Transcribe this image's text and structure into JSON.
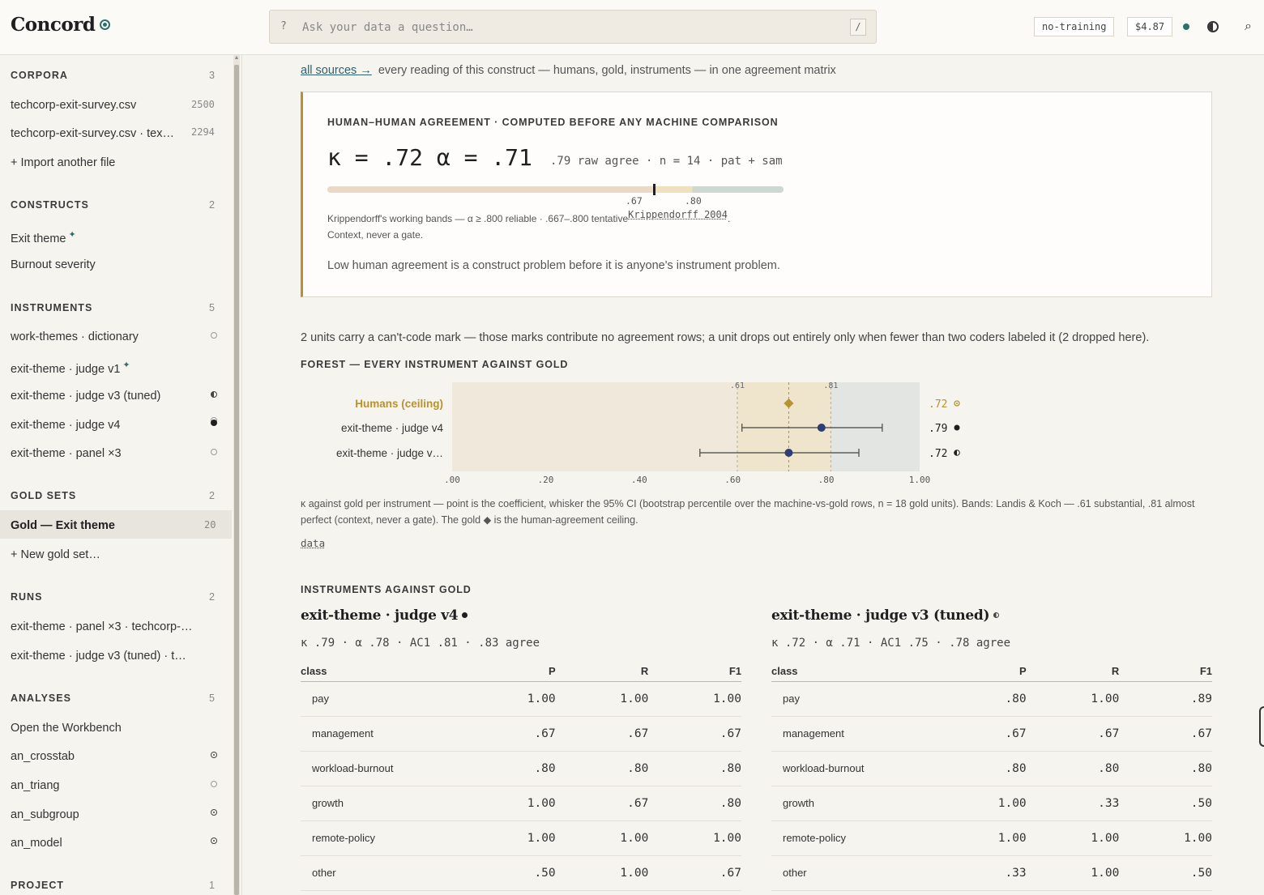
{
  "app": {
    "name": "Concord"
  },
  "search": {
    "prefix": "?",
    "placeholder": "Ask your data a question…",
    "shortcut": "/"
  },
  "topbar": {
    "mode": "no-training",
    "cost": "$4.87"
  },
  "sidebar": {
    "corpora": {
      "title": "CORPORA",
      "count": "3",
      "items": [
        {
          "label": "techcorp-exit-survey.csv",
          "num": "2500"
        },
        {
          "label": "techcorp-exit-survey.csv · tex…",
          "num": "2294"
        },
        {
          "label": "+ Import another file"
        }
      ]
    },
    "constructs": {
      "title": "CONSTRUCTS",
      "count": "2",
      "items": [
        {
          "label": "Exit theme",
          "badge": "✦"
        },
        {
          "label": "Burnout severity"
        }
      ]
    },
    "instruments": {
      "title": "INSTRUMENTS",
      "count": "5",
      "items": [
        {
          "label": "work-themes · dictionary"
        },
        {
          "label": "exit-theme · judge v1",
          "badge": "✦"
        },
        {
          "label": "exit-theme · judge v3 (tuned)"
        },
        {
          "label": "exit-theme · judge v4"
        },
        {
          "label": "exit-theme · panel ×3"
        }
      ]
    },
    "gold_sets": {
      "title": "GOLD SETS",
      "count": "2",
      "items": [
        {
          "label": "Gold — Exit theme",
          "num": "20"
        },
        {
          "label": "+ New gold set…"
        }
      ]
    },
    "runs": {
      "title": "RUNS",
      "count": "2",
      "items": [
        {
          "label": "exit-theme · panel ×3 · techcorp-…"
        },
        {
          "label": "exit-theme · judge v3 (tuned) · t…"
        }
      ]
    },
    "analyses": {
      "title": "ANALYSES",
      "count": "5",
      "items": [
        {
          "label": "Open the Workbench"
        },
        {
          "label": "an_crosstab"
        },
        {
          "label": "an_triang"
        },
        {
          "label": "an_subgroup"
        },
        {
          "label": "an_model"
        }
      ]
    },
    "project": {
      "title": "PROJECT",
      "count": "1"
    }
  },
  "main": {
    "all_sources_link": "all sources →",
    "all_sources_text": "every reading of this construct — humans, gold, instruments — in one agreement matrix",
    "agreement": {
      "heading": "HUMAN–HUMAN AGREEMENT · COMPUTED BEFORE ANY MACHINE COMPARISON",
      "headline": "κ = .72 α = .71",
      "sub": ".79 raw agree · n = 14 · pat + sam",
      "alpha_value": 0.71,
      "tick_67": ".67",
      "tick_80": ".80",
      "bands_text": "Krippendorff's working bands — α ≥ .800 reliable · .667–.800 tentative",
      "citation": "Krippendorff 2004",
      "citation_end": ".",
      "context": "Context, never a gate.",
      "note": "Low human agreement is a construct problem before it is anyone's instrument problem."
    },
    "units_note": "2 units carry a can't-code mark — those marks contribute no agreement rows; a unit drops out entirely only when fewer than two coders labeled it (2 dropped here).",
    "forest_heading": "FOREST — EVERY INSTRUMENT AGAINST GOLD",
    "forest_caption": "κ against gold per instrument — point is the coefficient, whisker the 95% CI (bootstrap percentile over the machine-vs-gold rows, n = 18 gold units). Bands: Landis & Koch — .61 substantial, .81 almost perfect (context, never a gate). The gold ◆ is the human-agreement ceiling.",
    "data_link": "data",
    "instruments_heading": "INSTRUMENTS AGAINST GOLD",
    "panels": [
      {
        "title": "exit-theme · judge v4",
        "stats": "κ .79 · α .78 · AC1 .81 · .83 agree",
        "headers": [
          "class",
          "P",
          "R",
          "F1"
        ],
        "rows": [
          [
            "pay",
            "1.00",
            "1.00",
            "1.00"
          ],
          [
            "management",
            ".67",
            ".67",
            ".67"
          ],
          [
            "workload-burnout",
            ".80",
            ".80",
            ".80"
          ],
          [
            "growth",
            "1.00",
            ".67",
            ".80"
          ],
          [
            "remote-policy",
            "1.00",
            "1.00",
            "1.00"
          ],
          [
            "other",
            ".50",
            "1.00",
            ".67"
          ]
        ]
      },
      {
        "title": "exit-theme · judge v3 (tuned)",
        "stats": "κ .72 · α .71 · AC1 .75 · .78 agree",
        "headers": [
          "class",
          "P",
          "R",
          "F1"
        ],
        "rows": [
          [
            "pay",
            ".80",
            "1.00",
            ".89"
          ],
          [
            "management",
            ".67",
            ".67",
            ".67"
          ],
          [
            "workload-burnout",
            ".80",
            ".80",
            ".80"
          ],
          [
            "growth",
            "1.00",
            ".33",
            ".50"
          ],
          [
            "remote-policy",
            "1.00",
            "1.00",
            "1.00"
          ],
          [
            "other",
            ".33",
            "1.00",
            ".50"
          ]
        ]
      }
    ]
  },
  "chart_data": {
    "type": "scatter",
    "title": "FOREST — EVERY INSTRUMENT AGAINST GOLD",
    "xlim": [
      0,
      1
    ],
    "x_ticks": [
      ".00",
      ".20",
      ".40",
      ".60",
      ".80",
      "1.00"
    ],
    "bands": [
      {
        "label": ".61",
        "value": 0.61
      },
      {
        "label": ".81",
        "value": 0.81
      }
    ],
    "ceiling": 0.72,
    "series": [
      {
        "name": "Humans (ceiling)",
        "value": 0.72,
        "ci": null,
        "label": ".72"
      },
      {
        "name": "exit-theme · judge v4",
        "value": 0.79,
        "ci": [
          0.62,
          0.92
        ],
        "label": ".79"
      },
      {
        "name": "exit-theme · judge v…",
        "value": 0.72,
        "ci": [
          0.53,
          0.87
        ],
        "label": ".72"
      }
    ],
    "colors": {
      "human": "#b8922e",
      "instrument": "#2c3e74"
    }
  }
}
